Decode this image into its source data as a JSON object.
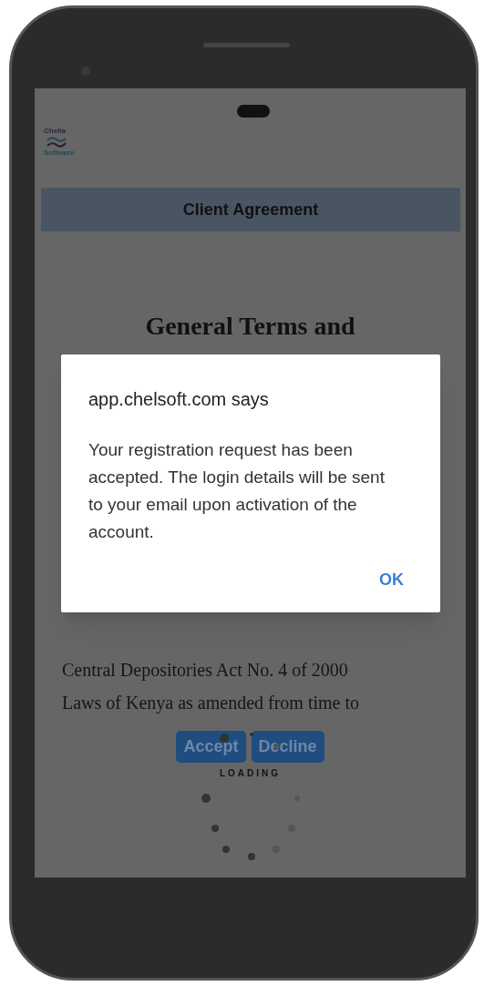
{
  "logo": {
    "top_text": "Chella",
    "bottom_text": "Software"
  },
  "header": {
    "title": "Client Agreement"
  },
  "document": {
    "heading": "General Terms and",
    "lines": [
      "Central Depositories Act No. 4 of 2000",
      "Laws of Kenya as amended from time to"
    ]
  },
  "actions": [
    {
      "label": "Accept"
    },
    {
      "label": "Decline"
    }
  ],
  "loading": {
    "label": "LOADING"
  },
  "dialog": {
    "title": "app.chelsoft.com says",
    "message": "Your registration request has been accepted. The login details will be sent to your email upon activation of the account.",
    "button": "OK"
  }
}
